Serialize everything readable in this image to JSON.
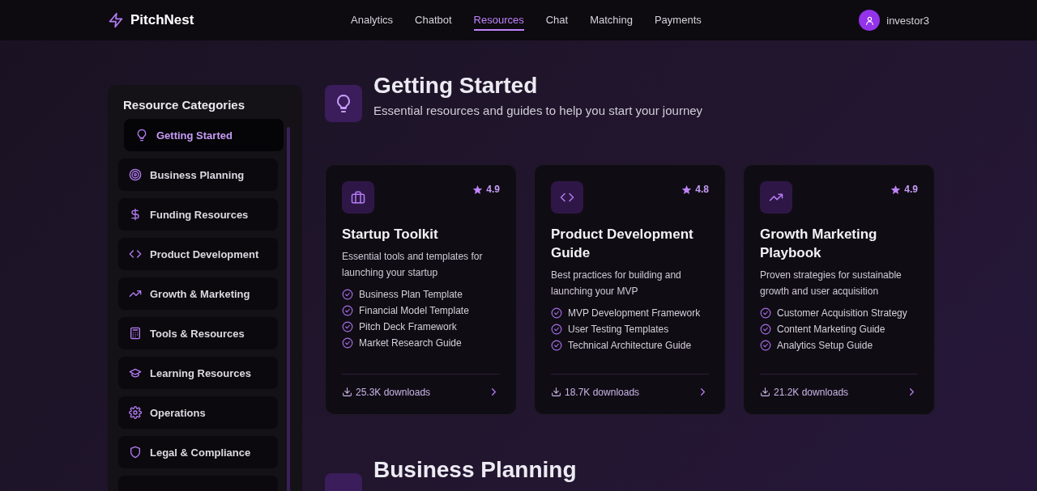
{
  "brand": "PitchNest",
  "nav": [
    {
      "label": "Analytics",
      "selected": false
    },
    {
      "label": "Chatbot",
      "selected": false
    },
    {
      "label": "Resources",
      "selected": true
    },
    {
      "label": "Chat",
      "selected": false
    },
    {
      "label": "Matching",
      "selected": false
    },
    {
      "label": "Payments",
      "selected": false
    }
  ],
  "user": {
    "name": "investor3"
  },
  "sidebar": {
    "title": "Resource Categories",
    "items": [
      {
        "label": "Getting Started",
        "selected": true
      },
      {
        "label": "Business Planning",
        "selected": false
      },
      {
        "label": "Funding Resources",
        "selected": false
      },
      {
        "label": "Product Development",
        "selected": false
      },
      {
        "label": "Growth & Marketing",
        "selected": false
      },
      {
        "label": "Tools & Resources",
        "selected": false
      },
      {
        "label": "Learning Resources",
        "selected": false
      },
      {
        "label": "Operations",
        "selected": false
      },
      {
        "label": "Legal & Compliance",
        "selected": false
      }
    ]
  },
  "section": {
    "title": "Getting Started",
    "subtitle": "Essential resources and guides to help you start your journey",
    "cards": [
      {
        "title": "Startup Toolkit",
        "rating": "4.9",
        "description": "Essential tools and templates for launching your startup",
        "items": [
          "Business Plan Template",
          "Financial Model Template",
          "Pitch Deck Framework",
          "Market Research Guide"
        ],
        "downloads": "25.3K downloads"
      },
      {
        "title": "Product Development Guide",
        "rating": "4.8",
        "description": "Best practices for building and launching your MVP",
        "items": [
          "MVP Development Framework",
          "User Testing Templates",
          "Technical Architecture Guide"
        ],
        "downloads": "18.7K downloads"
      },
      {
        "title": "Growth Marketing Playbook",
        "rating": "4.9",
        "description": "Proven strategies for sustainable growth and user acquisition",
        "items": [
          "Customer Acquisition Strategy",
          "Content Marketing Guide",
          "Analytics Setup Guide"
        ],
        "downloads": "21.2K downloads"
      }
    ]
  },
  "next_section": {
    "title": "Business Planning"
  }
}
